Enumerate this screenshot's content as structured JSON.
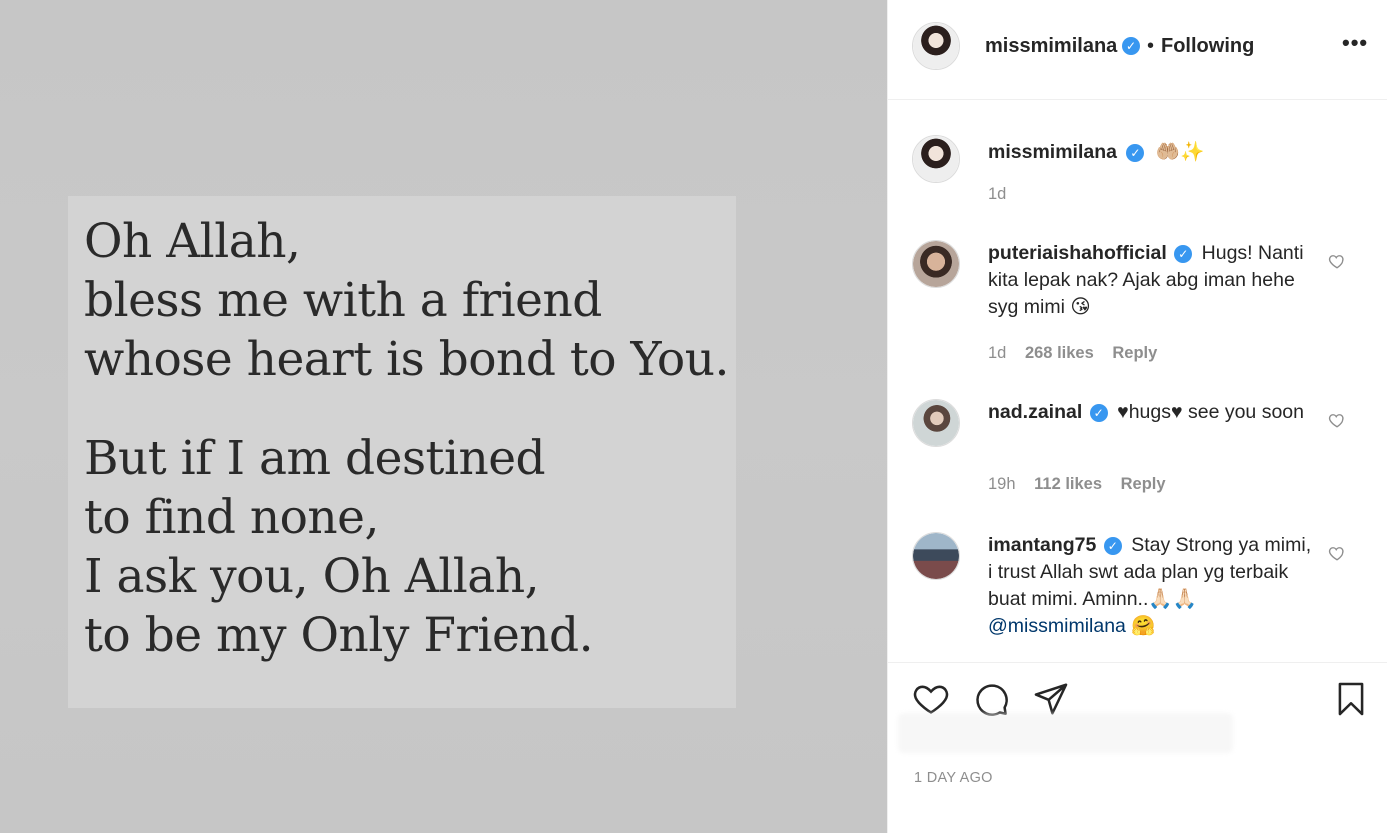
{
  "post": {
    "quote_lines_1": [
      "Oh Allah,",
      "bless me with a friend",
      "whose heart is bond to You."
    ],
    "quote_lines_2": [
      "But if I am destined",
      "to find none,",
      "I ask you, Oh Allah,",
      "to be my Only Friend."
    ]
  },
  "header": {
    "username": "missmimilana",
    "separator": "•",
    "follow_status": "Following",
    "more_label": "•••"
  },
  "caption": {
    "username": "missmimilana",
    "text": "🤲🏼✨",
    "time": "1d"
  },
  "comments": [
    {
      "username": "puteriaishahofficial",
      "text": "Hugs! Nanti kita lepak nak? Ajak abg iman hehe syg mimi 😘",
      "time": "1d",
      "likes": "268 likes",
      "reply": "Reply"
    },
    {
      "username": "nad.zainal",
      "text": "♥hugs♥ see you soon",
      "time": "19h",
      "likes": "112 likes",
      "reply": "Reply"
    },
    {
      "username": "imantang75",
      "text": "Stay Strong ya mimi, i trust Allah swt ada plan yg terbaik buat mimi. Aminn..🙏🏻🙏🏻",
      "mention": "@missmimilana",
      "emoji_after_mention": "🤗"
    }
  ],
  "footer": {
    "timestamp": "1 DAY AGO"
  },
  "icons": {
    "like": "heart-icon",
    "comment": "comment-icon",
    "share": "paper-plane-icon",
    "save": "bookmark-icon",
    "verified": "verified-badge-icon",
    "more": "more-options-icon"
  },
  "colors": {
    "verified": "#3897f0",
    "mention": "#00376b",
    "muted": "#8e8e8e",
    "text": "#262626"
  }
}
